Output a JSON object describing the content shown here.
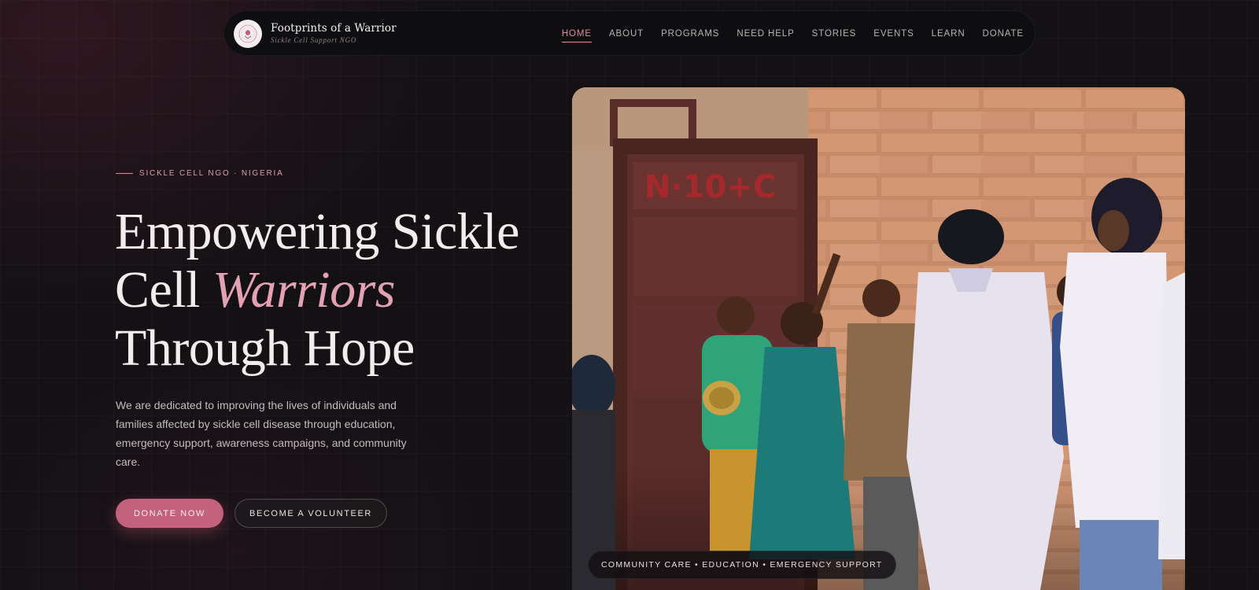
{
  "brand": {
    "title": "Footprints of a Warrior",
    "subtitle": "Sickle Cell Support NGO"
  },
  "nav": {
    "items": [
      {
        "label": "HOME",
        "active": true
      },
      {
        "label": "ABOUT",
        "active": false
      },
      {
        "label": "PROGRAMS",
        "active": false
      },
      {
        "label": "NEED HELP",
        "active": false
      },
      {
        "label": "STORIES",
        "active": false
      },
      {
        "label": "EVENTS",
        "active": false
      },
      {
        "label": "LEARN",
        "active": false
      },
      {
        "label": "DONATE",
        "active": false
      }
    ]
  },
  "hero": {
    "eyebrow": "SICKLE CELL NGO · NIGERIA",
    "headline_part1": "Empowering Sickle Cell ",
    "headline_emphasis": "Warriors",
    "headline_part2": " Through Hope",
    "description": "We are dedicated to improving the lives of individuals and families affected by sickle cell disease through education, emergency support, awareness campaigns, and community care.",
    "primary_button": "DONATE NOW",
    "secondary_button": "BECOME A VOLUNTEER",
    "image_caption": "COMMUNITY CARE • EDUCATION • EMERGENCY SUPPORT",
    "door_graffiti": "N·10+C"
  },
  "colors": {
    "accent": "#c4627d",
    "accent_light": "#e3a1b2",
    "background": "#131114"
  }
}
